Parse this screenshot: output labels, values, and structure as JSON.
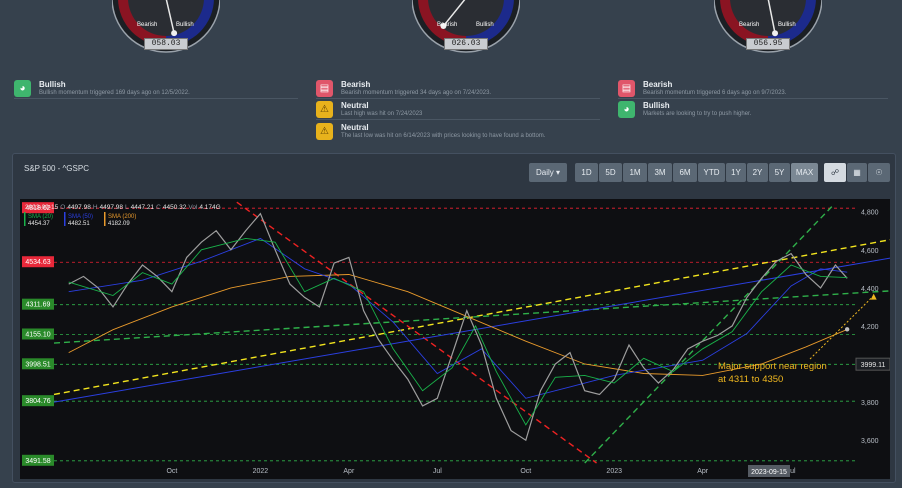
{
  "gauges": [
    {
      "bear_label": "Bearish",
      "bull_label": "Bullish",
      "reading": "058.03",
      "value": 58.03
    },
    {
      "bear_label": "Bearish",
      "bull_label": "Bullish",
      "reading": "026.03",
      "value": 26.03
    },
    {
      "bear_label": "Bearish",
      "bull_label": "Bullish",
      "reading": "056.95",
      "value": 56.95
    }
  ],
  "signals": [
    {
      "kind": "bullish",
      "icon": "gauge-icon",
      "title": "Bullish",
      "desc": "Bullish momentum triggered 169 days ago on 12/5/2022."
    },
    {
      "kind": "bearish",
      "icon": "gauge-icon",
      "title": "Bearish",
      "desc": "Bearish momentum triggered 34 days ago on 7/24/2023."
    },
    {
      "kind": "neutral",
      "icon": "warning-icon",
      "title": "Neutral",
      "desc": "Last high was hit on 7/24/2023"
    },
    {
      "kind": "neutral",
      "icon": "warning-icon",
      "title": "Neutral",
      "desc": "The last low was hit on 6/14/2023 with prices looking to have found a bottom."
    },
    {
      "kind": "bearish",
      "icon": "gauge-icon",
      "title": "Bearish",
      "desc": "Bearish momentum triggered 6 days ago on 9/7/2023."
    },
    {
      "kind": "bullish",
      "icon": "gauge-icon",
      "title": "Bullish",
      "desc": "Markets are looking to try to push higher."
    }
  ],
  "panel": {
    "title": "S&P 500 - ^GSPC",
    "interval": "Daily ▾",
    "ranges": [
      "1D",
      "5D",
      "1M",
      "3M",
      "6M",
      "YTD",
      "1Y",
      "2Y",
      "5Y",
      "MAX"
    ],
    "active_range": "MAX",
    "tools": [
      "share-nodes-icon",
      "calculator-icon",
      "globe-icon"
    ]
  },
  "colors": {
    "price": "#9e9e9e",
    "sma20": "#19b24a",
    "sma50": "#2b3fe0",
    "sma200": "#e89a2c",
    "resistance": "#ee2233",
    "support": "#2fb04a",
    "trend_yellow": "#f2e41e",
    "trend_red": "#ee2222",
    "annotation": "#f0b820"
  },
  "chart_data": {
    "type": "line",
    "ohlc_text": {
      "date": "2023-09-15",
      "o_label": "O",
      "o": "4497.98",
      "h_label": "H",
      "h": "4497.98",
      "l_label": "L",
      "l": "4447.21",
      "c_label": "C",
      "c": "4450.32",
      "v_label": "Vol",
      "v": "4.174G"
    },
    "legend": [
      {
        "name": "SMA (20)",
        "value": "4454.37",
        "color": "#19b24a"
      },
      {
        "name": "SMA (50)",
        "value": "4482.51",
        "color": "#2b3fe0"
      },
      {
        "name": "SMA (200)",
        "value": "4182.09",
        "color": "#e89a2c"
      }
    ],
    "x_ticks": [
      {
        "label": "Oct",
        "m": 4.0
      },
      {
        "label": "2022",
        "m": 7.0
      },
      {
        "label": "Apr",
        "m": 10.0
      },
      {
        "label": "Jul",
        "m": 13.0
      },
      {
        "label": "Oct",
        "m": 16.0
      },
      {
        "label": "2023",
        "m": 19.0
      },
      {
        "label": "Apr",
        "m": 22.0
      },
      {
        "label": "Jul",
        "m": 25.0
      }
    ],
    "x_range_months": [
      0,
      27.2
    ],
    "ylim": [
      3480,
      4830
    ],
    "y_ticks": [
      3600,
      3800,
      4000,
      4200,
      4400,
      4600,
      4800
    ],
    "y_tick_labels": [
      "3,600",
      "3,800",
      "4,000",
      "4,200",
      "4,400",
      "4,600",
      "4,800"
    ],
    "current_price_label": "3999.11",
    "current_date_label": "2023-09-15",
    "levels": [
      {
        "label": "4818.62",
        "value": 4818.62,
        "kind": "resistance"
      },
      {
        "label": "4534.63",
        "value": 4534.63,
        "kind": "resistance"
      },
      {
        "label": "4311.69",
        "value": 4311.69,
        "kind": "support"
      },
      {
        "label": "4155.10",
        "value": 4155.1,
        "kind": "support"
      },
      {
        "label": "3998.51",
        "value": 3998.51,
        "kind": "support"
      },
      {
        "label": "3804.76",
        "value": 3804.76,
        "kind": "support"
      },
      {
        "label": "3491.58",
        "value": 3491.58,
        "kind": "support"
      }
    ],
    "price": [
      {
        "m": 0.5,
        "y": 4420
      },
      {
        "m": 1.0,
        "y": 4460
      },
      {
        "m": 1.5,
        "y": 4400
      },
      {
        "m": 2.0,
        "y": 4300
      },
      {
        "m": 2.5,
        "y": 4420
      },
      {
        "m": 3.0,
        "y": 4520
      },
      {
        "m": 3.5,
        "y": 4460
      },
      {
        "m": 4.0,
        "y": 4380
      },
      {
        "m": 4.5,
        "y": 4560
      },
      {
        "m": 5.0,
        "y": 4640
      },
      {
        "m": 5.5,
        "y": 4700
      },
      {
        "m": 6.0,
        "y": 4600
      },
      {
        "m": 6.5,
        "y": 4700
      },
      {
        "m": 7.0,
        "y": 4790
      },
      {
        "m": 7.5,
        "y": 4600
      },
      {
        "m": 8.0,
        "y": 4420
      },
      {
        "m": 8.5,
        "y": 4350
      },
      {
        "m": 9.0,
        "y": 4300
      },
      {
        "m": 9.5,
        "y": 4530
      },
      {
        "m": 10.0,
        "y": 4560
      },
      {
        "m": 10.5,
        "y": 4280
      },
      {
        "m": 11.0,
        "y": 4130
      },
      {
        "m": 11.5,
        "y": 4020
      },
      {
        "m": 12.0,
        "y": 3920
      },
      {
        "m": 12.5,
        "y": 3780
      },
      {
        "m": 13.0,
        "y": 3820
      },
      {
        "m": 13.5,
        "y": 4050
      },
      {
        "m": 14.0,
        "y": 4280
      },
      {
        "m": 14.5,
        "y": 4100
      },
      {
        "m": 15.0,
        "y": 3820
      },
      {
        "m": 15.5,
        "y": 3650
      },
      {
        "m": 16.0,
        "y": 3600
      },
      {
        "m": 16.5,
        "y": 3860
      },
      {
        "m": 17.0,
        "y": 4000
      },
      {
        "m": 17.5,
        "y": 4060
      },
      {
        "m": 18.0,
        "y": 3860
      },
      {
        "m": 18.5,
        "y": 3840
      },
      {
        "m": 19.0,
        "y": 3920
      },
      {
        "m": 19.5,
        "y": 4100
      },
      {
        "m": 20.0,
        "y": 3980
      },
      {
        "m": 20.5,
        "y": 3900
      },
      {
        "m": 21.0,
        "y": 3970
      },
      {
        "m": 21.5,
        "y": 4080
      },
      {
        "m": 22.0,
        "y": 4120
      },
      {
        "m": 22.5,
        "y": 4150
      },
      {
        "m": 23.0,
        "y": 4200
      },
      {
        "m": 23.5,
        "y": 4350
      },
      {
        "m": 24.0,
        "y": 4450
      },
      {
        "m": 24.5,
        "y": 4540
      },
      {
        "m": 25.0,
        "y": 4580
      },
      {
        "m": 25.5,
        "y": 4470
      },
      {
        "m": 26.0,
        "y": 4400
      },
      {
        "m": 26.5,
        "y": 4520
      },
      {
        "m": 26.9,
        "y": 4450
      }
    ],
    "sma20": [
      {
        "m": 0.5,
        "y": 4430
      },
      {
        "m": 2.0,
        "y": 4360
      },
      {
        "m": 3.0,
        "y": 4480
      },
      {
        "m": 4.0,
        "y": 4420
      },
      {
        "m": 5.0,
        "y": 4600
      },
      {
        "m": 6.5,
        "y": 4660
      },
      {
        "m": 7.5,
        "y": 4640
      },
      {
        "m": 8.5,
        "y": 4380
      },
      {
        "m": 9.5,
        "y": 4450
      },
      {
        "m": 10.5,
        "y": 4380
      },
      {
        "m": 11.5,
        "y": 4080
      },
      {
        "m": 12.5,
        "y": 3860
      },
      {
        "m": 13.5,
        "y": 3980
      },
      {
        "m": 14.3,
        "y": 4200
      },
      {
        "m": 15.0,
        "y": 3960
      },
      {
        "m": 16.0,
        "y": 3680
      },
      {
        "m": 17.0,
        "y": 3930
      },
      {
        "m": 18.0,
        "y": 3940
      },
      {
        "m": 19.0,
        "y": 3900
      },
      {
        "m": 20.0,
        "y": 4030
      },
      {
        "m": 21.0,
        "y": 3960
      },
      {
        "m": 22.0,
        "y": 4080
      },
      {
        "m": 23.0,
        "y": 4170
      },
      {
        "m": 24.0,
        "y": 4380
      },
      {
        "m": 25.0,
        "y": 4520
      },
      {
        "m": 26.0,
        "y": 4460
      },
      {
        "m": 26.9,
        "y": 4454
      }
    ],
    "sma50": [
      {
        "m": 0.5,
        "y": 4380
      },
      {
        "m": 3.0,
        "y": 4440
      },
      {
        "m": 5.0,
        "y": 4540
      },
      {
        "m": 7.0,
        "y": 4660
      },
      {
        "m": 8.5,
        "y": 4500
      },
      {
        "m": 10.0,
        "y": 4420
      },
      {
        "m": 11.5,
        "y": 4220
      },
      {
        "m": 13.0,
        "y": 3950
      },
      {
        "m": 14.5,
        "y": 4080
      },
      {
        "m": 16.0,
        "y": 3820
      },
      {
        "m": 17.5,
        "y": 3880
      },
      {
        "m": 19.0,
        "y": 3940
      },
      {
        "m": 20.5,
        "y": 3980
      },
      {
        "m": 22.0,
        "y": 4020
      },
      {
        "m": 23.5,
        "y": 4160
      },
      {
        "m": 25.0,
        "y": 4410
      },
      {
        "m": 26.0,
        "y": 4500
      },
      {
        "m": 26.9,
        "y": 4482
      }
    ],
    "sma200": [
      {
        "m": 0.5,
        "y": 4060
      },
      {
        "m": 2.0,
        "y": 4180
      },
      {
        "m": 4.0,
        "y": 4300
      },
      {
        "m": 6.0,
        "y": 4400
      },
      {
        "m": 8.0,
        "y": 4460
      },
      {
        "m": 10.0,
        "y": 4470
      },
      {
        "m": 12.0,
        "y": 4380
      },
      {
        "m": 14.0,
        "y": 4250
      },
      {
        "m": 16.0,
        "y": 4120
      },
      {
        "m": 18.0,
        "y": 4000
      },
      {
        "m": 20.0,
        "y": 3950
      },
      {
        "m": 22.0,
        "y": 3940
      },
      {
        "m": 24.0,
        "y": 4000
      },
      {
        "m": 25.5,
        "y": 4090
      },
      {
        "m": 26.9,
        "y": 4182
      }
    ],
    "trendlines": [
      {
        "kind": "trend_yellow",
        "from": {
          "m": 0.0,
          "y": 3840
        },
        "to": {
          "m": 30.0,
          "y": 4700
        }
      },
      {
        "kind": "trend_red",
        "from": {
          "m": 6.2,
          "y": 4850
        },
        "to": {
          "m": 18.4,
          "y": 3480
        }
      },
      {
        "kind": "support",
        "from": {
          "m": 0.0,
          "y": 4110
        },
        "to": {
          "m": 30.0,
          "y": 4400
        }
      },
      {
        "kind": "support",
        "from": {
          "m": 18.0,
          "y": 3480
        },
        "to": {
          "m": 26.4,
          "y": 4830
        }
      },
      {
        "kind": "sma50",
        "from": {
          "m": 0.0,
          "y": 3800
        },
        "to": {
          "m": 30.0,
          "y": 4600
        }
      }
    ],
    "annotation": {
      "text_lines": [
        "Major support near region",
        "at 4311 to 4350"
      ],
      "target": {
        "m": 27.8,
        "y": 4380
      }
    }
  }
}
